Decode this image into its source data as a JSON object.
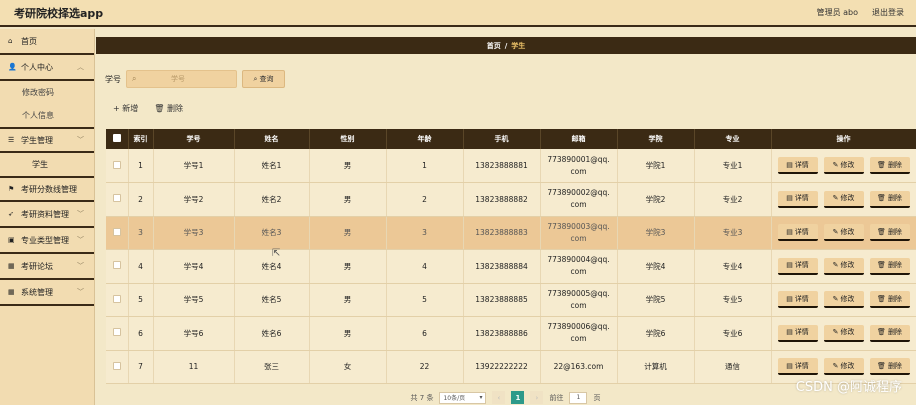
{
  "header": {
    "app_title": "考研院校择选app",
    "admin_label": "管理员 abo",
    "logout_label": "退出登录"
  },
  "sidebar": {
    "items": [
      {
        "label": "首页",
        "icon": "home-icon",
        "glyph": "⌂"
      },
      {
        "label": "个人中心",
        "icon": "user-icon",
        "glyph": "👤",
        "sub": [
          "修改密码",
          "个人信息"
        ]
      },
      {
        "label": "学生管理",
        "icon": "list-icon",
        "glyph": "☰",
        "sub": [
          "学生"
        ]
      },
      {
        "label": "考研分数线管理",
        "icon": "flag-icon",
        "glyph": "⚑"
      },
      {
        "label": "考研资料管理",
        "icon": "send-icon",
        "glyph": "➶"
      },
      {
        "label": "专业类型管理",
        "icon": "folder-icon",
        "glyph": "▣"
      },
      {
        "label": "考研论坛",
        "icon": "grid-icon",
        "glyph": "▦"
      },
      {
        "label": "系统管理",
        "icon": "grid-icon",
        "glyph": "▦"
      }
    ]
  },
  "breadcrumb": {
    "home": "首页",
    "separator": "/",
    "current": "学生"
  },
  "search": {
    "label": "学号",
    "placeholder": "学号",
    "button_label": "查询"
  },
  "actions": {
    "add_label": "+ 新增",
    "delete_label": "🗑 删除"
  },
  "table": {
    "columns": [
      "索引",
      "学号",
      "姓名",
      "性别",
      "年龄",
      "手机",
      "邮箱",
      "学院",
      "专业",
      "操作"
    ],
    "row_actions": [
      "详情",
      "修改",
      "删除"
    ],
    "rows": [
      {
        "index": "1",
        "student_id": "学号1",
        "name": "姓名1",
        "gender": "男",
        "age": "1",
        "phone": "13823888881",
        "email": "773890001@qq.com",
        "college": "学院1",
        "major": "专业1"
      },
      {
        "index": "2",
        "student_id": "学号2",
        "name": "姓名2",
        "gender": "男",
        "age": "2",
        "phone": "13823888882",
        "email": "773890002@qq.com",
        "college": "学院2",
        "major": "专业2"
      },
      {
        "index": "3",
        "student_id": "学号3",
        "name": "姓名3",
        "gender": "男",
        "age": "3",
        "phone": "13823888883",
        "email": "773890003@qq.com",
        "college": "学院3",
        "major": "专业3"
      },
      {
        "index": "4",
        "student_id": "学号4",
        "name": "姓名4",
        "gender": "男",
        "age": "4",
        "phone": "13823888884",
        "email": "773890004@qq.com",
        "college": "学院4",
        "major": "专业4"
      },
      {
        "index": "5",
        "student_id": "学号5",
        "name": "姓名5",
        "gender": "男",
        "age": "5",
        "phone": "13823888885",
        "email": "773890005@qq.com",
        "college": "学院5",
        "major": "专业5"
      },
      {
        "index": "6",
        "student_id": "学号6",
        "name": "姓名6",
        "gender": "男",
        "age": "6",
        "phone": "13823888886",
        "email": "773890006@qq.com",
        "college": "学院6",
        "major": "专业6"
      },
      {
        "index": "7",
        "student_id": "11",
        "name": "张三",
        "gender": "女",
        "age": "22",
        "phone": "13922222222",
        "email": "22@163.com",
        "college": "计算机",
        "major": "通信"
      }
    ]
  },
  "pagination": {
    "total": "共 7 条",
    "page_size": "10条/页",
    "current_page": "1",
    "goto_label": "前往",
    "goto_value": "1",
    "page_unit": "页"
  },
  "watermark": "CSDN @阿诚程序",
  "colors": {
    "dark_brown": "#3b2a14",
    "tan": "#f0d2a0",
    "cream": "#f6ebcf",
    "highlight": "#ecc896",
    "accent": "#2e9a8a"
  }
}
